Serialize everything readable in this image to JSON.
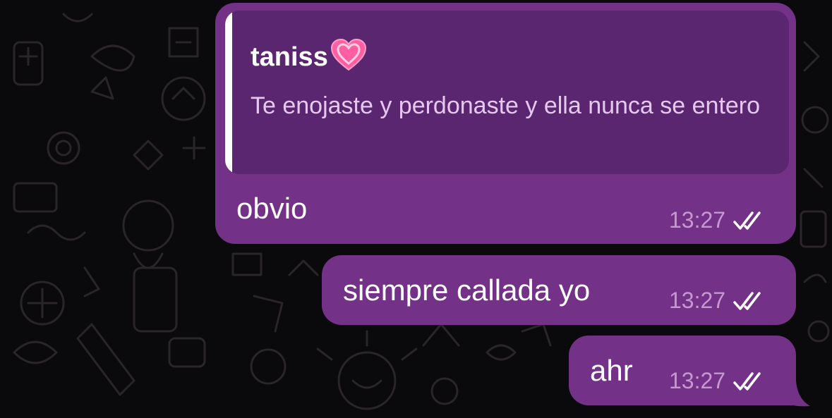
{
  "conversation": {
    "messages": [
      {
        "reply_to": {
          "author": "taniss",
          "author_emoji": "heart-icon",
          "text": "Te enojaste y perdonaste y ella nunca se entero"
        },
        "text": "obvio",
        "time": "13:27",
        "status": "read-double-check"
      },
      {
        "text": "siempre callada yo",
        "time": "13:27",
        "status": "read-double-check"
      },
      {
        "text": "ahr",
        "time": "13:27",
        "status": "read-double-check"
      }
    ]
  },
  "colors": {
    "background": "#0a090b",
    "outgoing_bubble": "#733188",
    "quote_background": "#5a2670",
    "quote_bar": "#ffffff",
    "timestamp": "#c698d2",
    "heart": "#ff5fa2"
  }
}
